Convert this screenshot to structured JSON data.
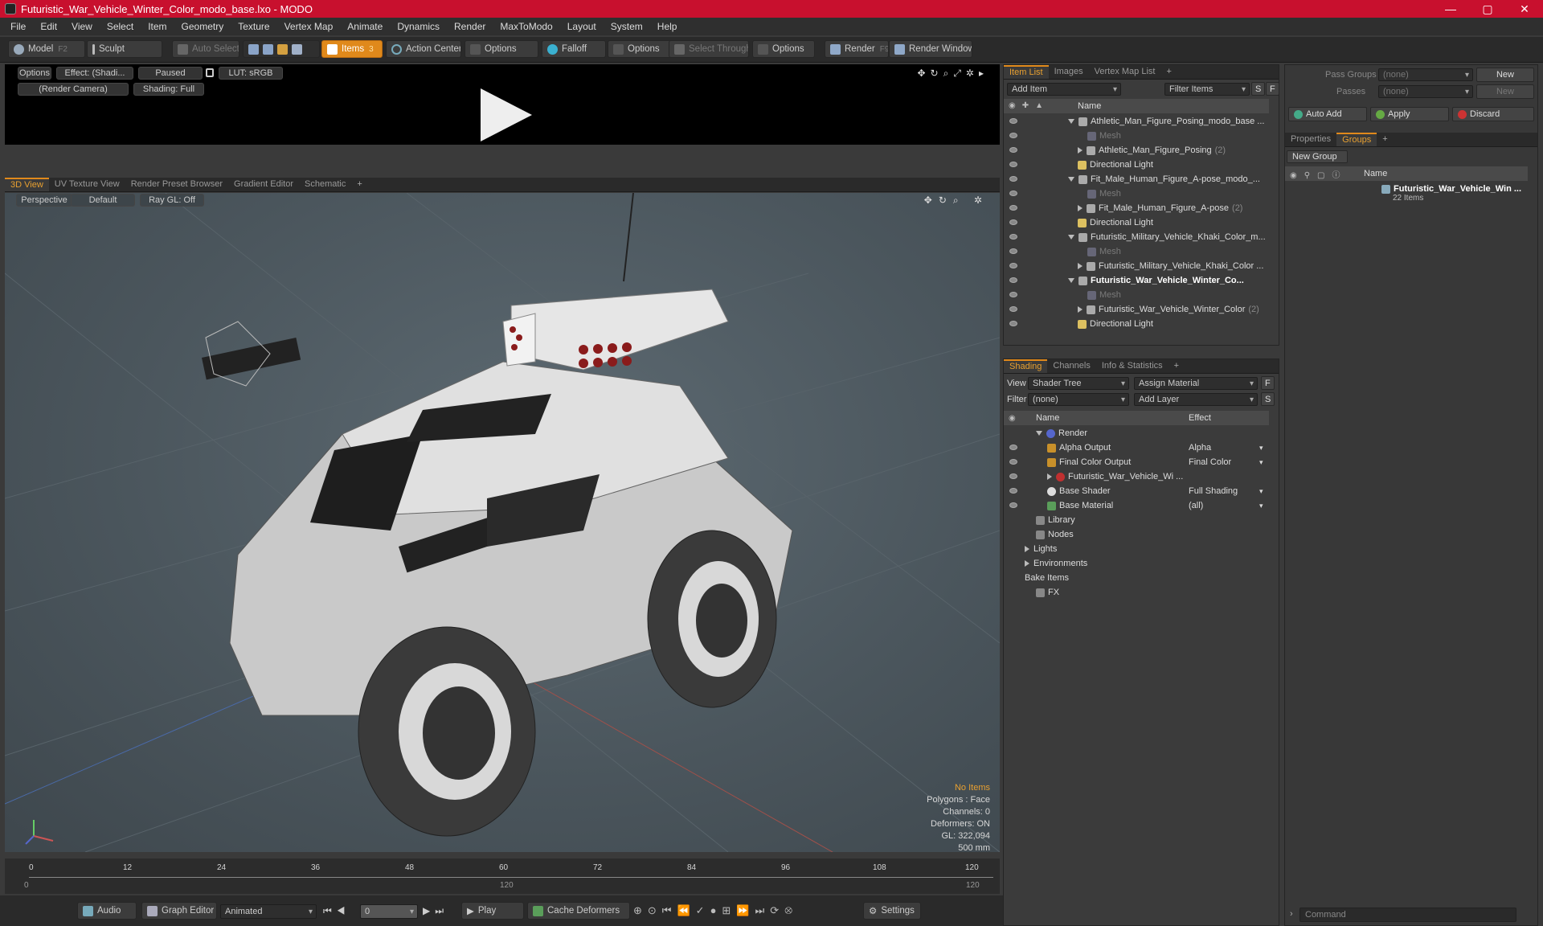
{
  "window": {
    "title": "Futuristic_War_Vehicle_Winter_Color_modo_base.lxo - MODO",
    "min": "—",
    "max": "▢",
    "close": "✕"
  },
  "menu": [
    "File",
    "Edit",
    "View",
    "Select",
    "Item",
    "Geometry",
    "Texture",
    "Vertex Map",
    "Animate",
    "Dynamics",
    "Render",
    "MaxToModo",
    "Layout",
    "System",
    "Help"
  ],
  "toolbar": {
    "model": "Model",
    "model_key": "F2",
    "sculpt": "Sculpt",
    "auto_select": "Auto Select",
    "items": "Items",
    "items_key": "3",
    "action_center": "Action Center",
    "options1": "Options",
    "falloff": "Falloff",
    "options2": "Options",
    "select_through": "Select Through",
    "options3": "Options",
    "render": "Render",
    "render_key": "F9",
    "render_window": "Render Window"
  },
  "preview": {
    "options": "Options",
    "effect": "Effect: (Shadi...",
    "paused": "Paused",
    "lut": "LUT: sRGB",
    "camera": "(Render Camera)",
    "shading": "Shading: Full"
  },
  "viewtabs": [
    "3D View",
    "UV Texture View",
    "Render Preset Browser",
    "Gradient Editor",
    "Schematic",
    "+"
  ],
  "viewport": {
    "perspective": "Perspective",
    "default": "Default",
    "raygl": "Ray GL: Off",
    "info": {
      "no_items": "No Items",
      "polygons": "Polygons : Face",
      "channels": "Channels: 0",
      "deformers": "Deformers: ON",
      "gl": "GL: 322,094",
      "scale": "500 mm"
    }
  },
  "timeline": {
    "ticks": [
      "0",
      "12",
      "24",
      "36",
      "48",
      "60",
      "72",
      "84",
      "96",
      "108",
      "120"
    ],
    "start": "0",
    "mid": "120",
    "end": "120"
  },
  "bottombar": {
    "audio": "Audio",
    "graph_editor": "Graph Editor",
    "animated": "Animated",
    "frame": "0",
    "play": "Play",
    "cache": "Cache Deformers",
    "settings": "Settings"
  },
  "itemlist": {
    "tabs": [
      "Item List",
      "Images",
      "Vertex Map List",
      "+"
    ],
    "add_item": "Add Item",
    "filter": "Filter Items",
    "s": "S",
    "f": "F",
    "col_name": "Name",
    "rows": [
      {
        "label": "Athletic_Man_Figure_Posing_modo_base ...",
        "indent": 0,
        "style": "normal",
        "exp": "down"
      },
      {
        "label": "Mesh",
        "indent": 2,
        "style": "dim",
        "exp": ""
      },
      {
        "label": "Athletic_Man_Figure_Posing",
        "count": "(2)",
        "indent": 1,
        "style": "normal",
        "exp": "right"
      },
      {
        "label": "Directional Light",
        "indent": 1,
        "style": "normal",
        "exp": ""
      },
      {
        "label": "Fit_Male_Human_Figure_A-pose_modo_...",
        "indent": 0,
        "style": "normal",
        "exp": "down"
      },
      {
        "label": "Mesh",
        "indent": 2,
        "style": "dim",
        "exp": ""
      },
      {
        "label": "Fit_Male_Human_Figure_A-pose",
        "count": "(2)",
        "indent": 1,
        "style": "normal",
        "exp": "right"
      },
      {
        "label": "Directional Light",
        "indent": 1,
        "style": "normal",
        "exp": ""
      },
      {
        "label": "Futuristic_Military_Vehicle_Khaki_Color_m...",
        "indent": 0,
        "style": "normal",
        "exp": "down"
      },
      {
        "label": "Mesh",
        "indent": 2,
        "style": "dim",
        "exp": ""
      },
      {
        "label": "Futuristic_Military_Vehicle_Khaki_Color ...",
        "indent": 1,
        "style": "normal",
        "exp": "right"
      },
      {
        "label": "Futuristic_War_Vehicle_Winter_Co...",
        "indent": 0,
        "style": "bold",
        "exp": "down"
      },
      {
        "label": "Mesh",
        "indent": 2,
        "style": "dim",
        "exp": ""
      },
      {
        "label": "Futuristic_War_Vehicle_Winter_Color",
        "count": "(2)",
        "indent": 1,
        "style": "normal",
        "exp": "right"
      },
      {
        "label": "Directional Light",
        "indent": 1,
        "style": "normal",
        "exp": ""
      }
    ]
  },
  "shading": {
    "tabs": [
      "Shading",
      "Channels",
      "Info & Statistics",
      "+"
    ],
    "view_label": "View",
    "view_value": "Shader Tree",
    "assign": "Assign Material",
    "f": "F",
    "filter_label": "Filter",
    "filter_value": "(none)",
    "add_layer": "Add Layer",
    "s": "S",
    "col_name": "Name",
    "col_effect": "Effect",
    "rows": [
      {
        "label": "Render",
        "effect": "",
        "indent": 0,
        "exp": "down",
        "color": "#5566cc"
      },
      {
        "label": "Alpha Output",
        "effect": "Alpha",
        "indent": 1,
        "exp": "",
        "color": "#c8902a"
      },
      {
        "label": "Final Color Output",
        "effect": "Final Color",
        "indent": 1,
        "exp": "",
        "color": "#c8902a"
      },
      {
        "label": "Futuristic_War_Vehicle_Wi ...",
        "effect": "",
        "indent": 1,
        "exp": "right",
        "color": "#c03030"
      },
      {
        "label": "Base Shader",
        "effect": "Full Shading",
        "indent": 1,
        "exp": "",
        "color": "#dddddd"
      },
      {
        "label": "Base Material",
        "effect": "(all)",
        "indent": 1,
        "exp": "",
        "color": "#5a9e5a"
      },
      {
        "label": "Library",
        "effect": "",
        "indent": 0,
        "exp": "",
        "color": "#888888"
      },
      {
        "label": "Nodes",
        "effect": "",
        "indent": 0,
        "exp": "",
        "color": "#888888"
      },
      {
        "label": "Lights",
        "effect": "",
        "indent": -1,
        "exp": "right",
        "color": ""
      },
      {
        "label": "Environments",
        "effect": "",
        "indent": -1,
        "exp": "right",
        "color": ""
      },
      {
        "label": "Bake Items",
        "effect": "",
        "indent": -1,
        "exp": "",
        "color": ""
      },
      {
        "label": "FX",
        "effect": "",
        "indent": 0,
        "exp": "",
        "color": "#888888"
      }
    ]
  },
  "groups": {
    "pass_groups": "Pass Groups",
    "pass_value": "(none)",
    "new": "New",
    "passes": "Passes",
    "passes_value": "(none)",
    "new2": "New",
    "auto_add": "Auto Add",
    "apply": "Apply",
    "discard": "Discard",
    "tabs": [
      "Properties",
      "Groups",
      "+"
    ],
    "new_group": "New Group",
    "col_name": "Name",
    "group_name": "Futuristic_War_Vehicle_Win ...",
    "group_count": "22 Items"
  },
  "command": {
    "placeholder": "Command"
  }
}
